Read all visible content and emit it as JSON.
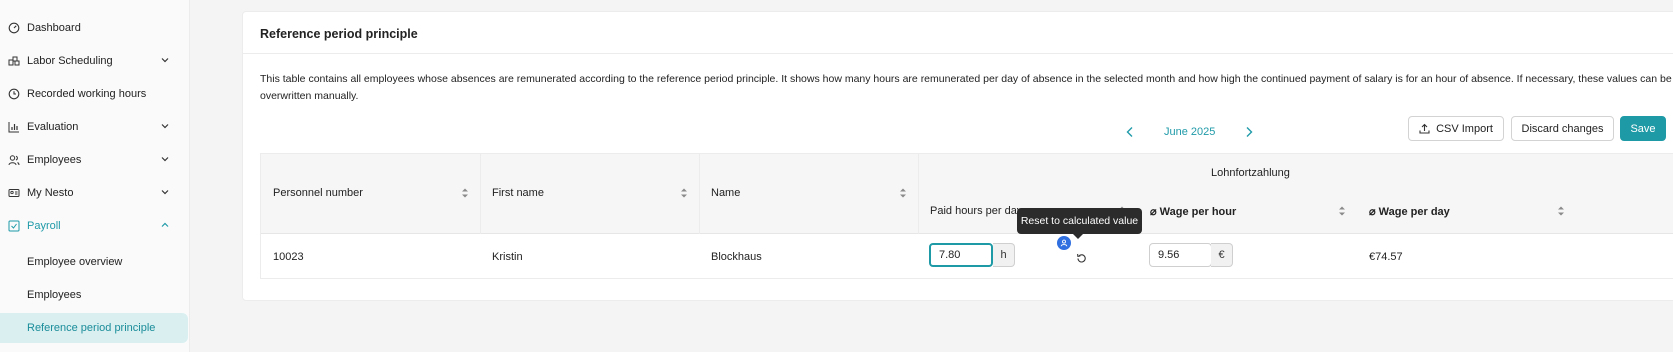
{
  "sidebar": {
    "items": [
      {
        "label": "Dashboard",
        "icon": "dashboard-icon",
        "expandable": false
      },
      {
        "label": "Labor Scheduling",
        "icon": "scheduling-icon",
        "expandable": true
      },
      {
        "label": "Recorded working hours",
        "icon": "clock-icon",
        "expandable": false
      },
      {
        "label": "Evaluation",
        "icon": "chart-icon",
        "expandable": true
      },
      {
        "label": "Employees",
        "icon": "people-icon",
        "expandable": true
      },
      {
        "label": "My Nesto",
        "icon": "id-card-icon",
        "expandable": true
      },
      {
        "label": "Payroll",
        "icon": "payroll-icon",
        "expandable": true,
        "expanded": true
      }
    ],
    "subitems": [
      {
        "label": "Employee overview"
      },
      {
        "label": "Employees"
      },
      {
        "label": "Reference period principle",
        "selected": true
      }
    ]
  },
  "card": {
    "title": "Reference period principle",
    "description": "This table contains all employees whose absences are remunerated according to the reference period principle. It shows how many hours are remunerated per day of absence in the selected month and how high the continued payment of salary is for an hour of absence. If necessary, these values can be overwritten manually."
  },
  "month_nav": {
    "label": "June 2025"
  },
  "toolbar": {
    "csv_label": "CSV Import",
    "discard_label": "Discard changes",
    "save_label": "Save"
  },
  "table": {
    "group_header": "Lohnfortzahlung",
    "columns": {
      "personnel_number": "Personnel number",
      "first_name": "First name",
      "name": "Name",
      "paid_hours": "Paid hours per day",
      "wage_per_hour": "⌀ Wage per hour",
      "wage_per_day": "⌀ Wage per day"
    },
    "rows": [
      {
        "personnel_number": "10023",
        "first_name": "Kristin",
        "name": "Blockhaus",
        "paid_hours": "7.80",
        "paid_hours_unit": "h",
        "wage_per_hour": "9.56",
        "wage_per_hour_unit": "€",
        "wage_per_day": "€74.57"
      }
    ]
  },
  "tooltip": {
    "text": "Reset to calculated value"
  },
  "colors": {
    "accent": "#1e9aa6",
    "badge": "#2f6fe0",
    "tooltip_bg": "#2b2b2b"
  }
}
